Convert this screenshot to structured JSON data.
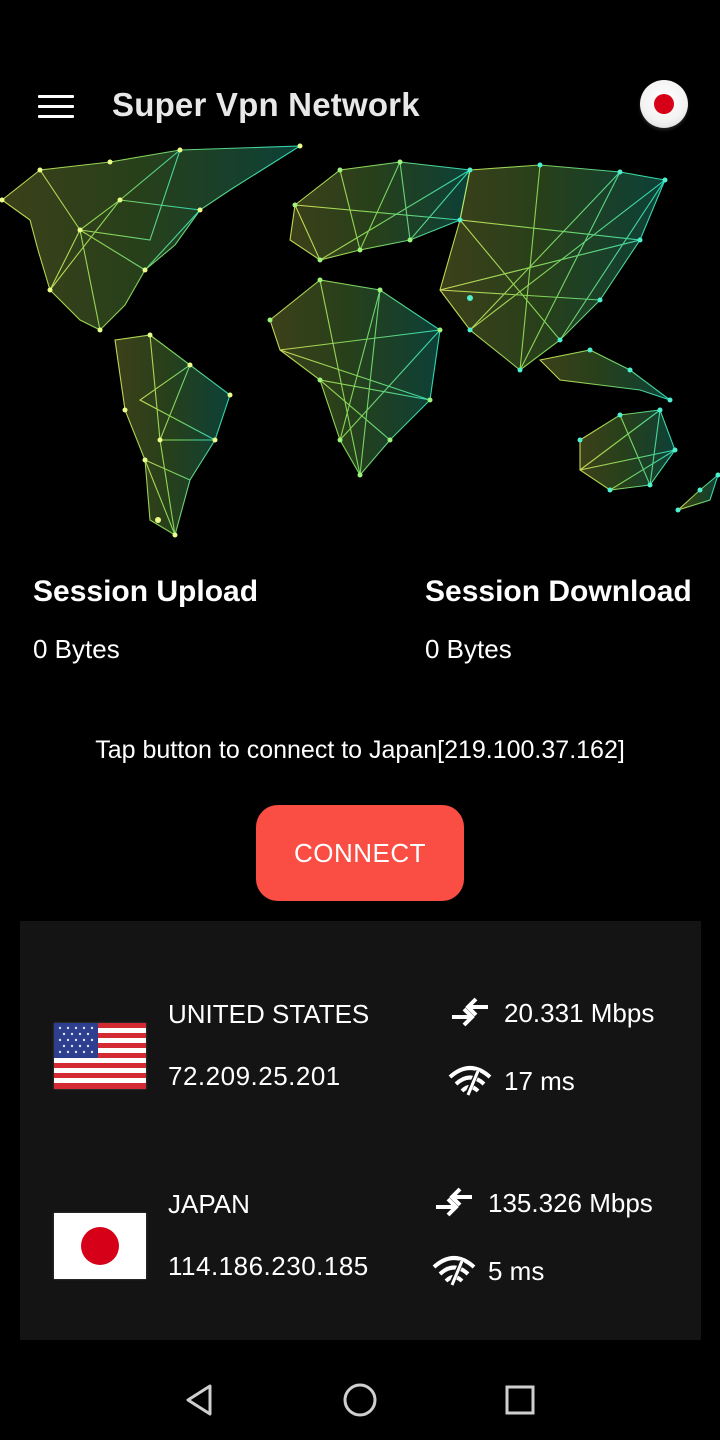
{
  "app": {
    "title": "Super Vpn Network",
    "menu_icon": "hamburger-menu-icon",
    "selected_flag": "japan-flag-icon"
  },
  "stats": {
    "upload_label": "Session Upload",
    "upload_value": "0 Bytes",
    "download_label": "Session Download",
    "download_value": "0 Bytes"
  },
  "connect": {
    "hint": "Tap button to connect to Japan[219.100.37.162]",
    "button_label": "CONNECT",
    "button_color": "#fa4e45"
  },
  "servers": [
    {
      "country": "UNITED STATES",
      "ip": "72.209.25.201",
      "speed": "20.331 Mbps",
      "ping": "17 ms",
      "flag": "usa-flag-icon"
    },
    {
      "country": "JAPAN",
      "ip": "114.186.230.185",
      "speed": "135.326 Mbps",
      "ping": "5 ms",
      "flag": "japan-flag-icon"
    }
  ],
  "colors": {
    "background": "#000000",
    "panel": "#141414",
    "map_west": "#d8e85a",
    "map_east": "#2ee8c6"
  },
  "nav": {
    "back_icon": "back-triangle-icon",
    "home_icon": "home-circle-icon",
    "recents_icon": "recents-square-icon"
  }
}
